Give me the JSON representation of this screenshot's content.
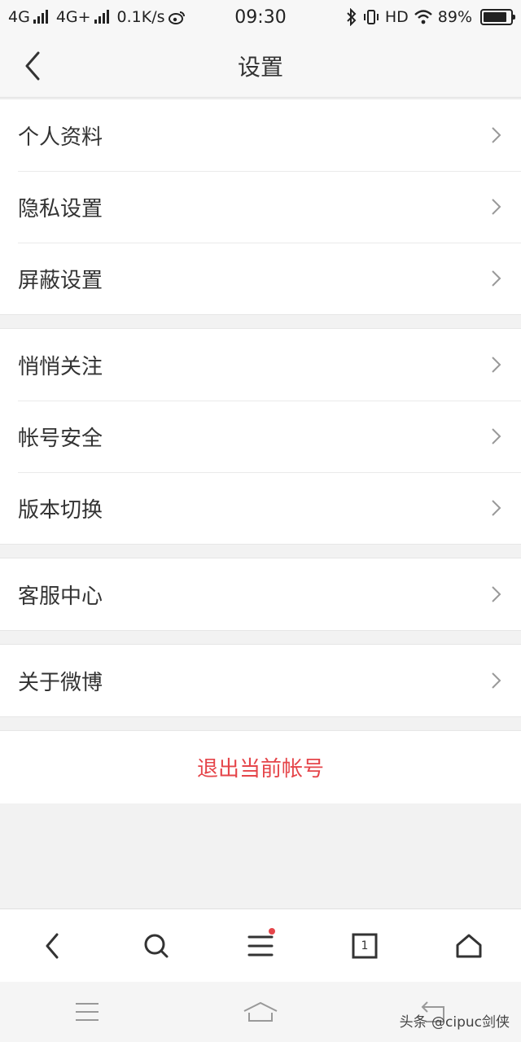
{
  "status_bar": {
    "network1": "4G",
    "network2": "4G+",
    "speed": "0.1K/s",
    "time": "09:30",
    "hd": "HD",
    "battery": "89%",
    "battery_level": 0.89
  },
  "nav": {
    "title": "设置"
  },
  "groups": [
    {
      "items": [
        {
          "label": "个人资料"
        },
        {
          "label": "隐私设置"
        },
        {
          "label": "屏蔽设置"
        }
      ]
    },
    {
      "items": [
        {
          "label": "悄悄关注"
        },
        {
          "label": "帐号安全"
        },
        {
          "label": "版本切换"
        }
      ]
    },
    {
      "items": [
        {
          "label": "客服中心"
        }
      ]
    },
    {
      "items": [
        {
          "label": "关于微博"
        }
      ]
    }
  ],
  "logout": {
    "label": "退出当前帐号"
  },
  "toolbar": {
    "tab_count": "1"
  },
  "watermark": "头条 @cipuc剑侠",
  "colors": {
    "accent_red": "#e5454a",
    "page_bg": "#f2f2f2"
  }
}
